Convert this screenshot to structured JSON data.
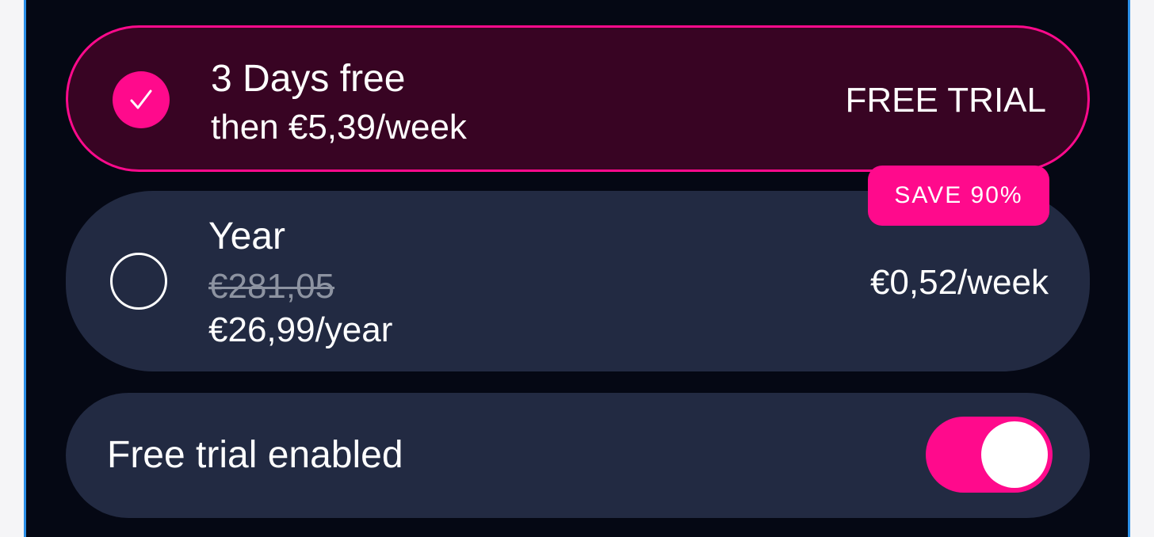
{
  "colors": {
    "accent": "#ff0a8c",
    "background": "#050814",
    "card": "#222a42",
    "selected_card": "#380423"
  },
  "plans": [
    {
      "title": "3 Days free",
      "subtitle": "then €5,39/week",
      "right_label": "FREE TRIAL",
      "selected": true,
      "icon": "checkmark-icon"
    },
    {
      "title": "Year",
      "original_price": "€281,05",
      "price": "€26,99/year",
      "right_label": "€0,52/week",
      "badge": "SAVE 90%",
      "selected": false
    }
  ],
  "free_trial_toggle": {
    "label": "Free trial enabled",
    "enabled": true
  }
}
